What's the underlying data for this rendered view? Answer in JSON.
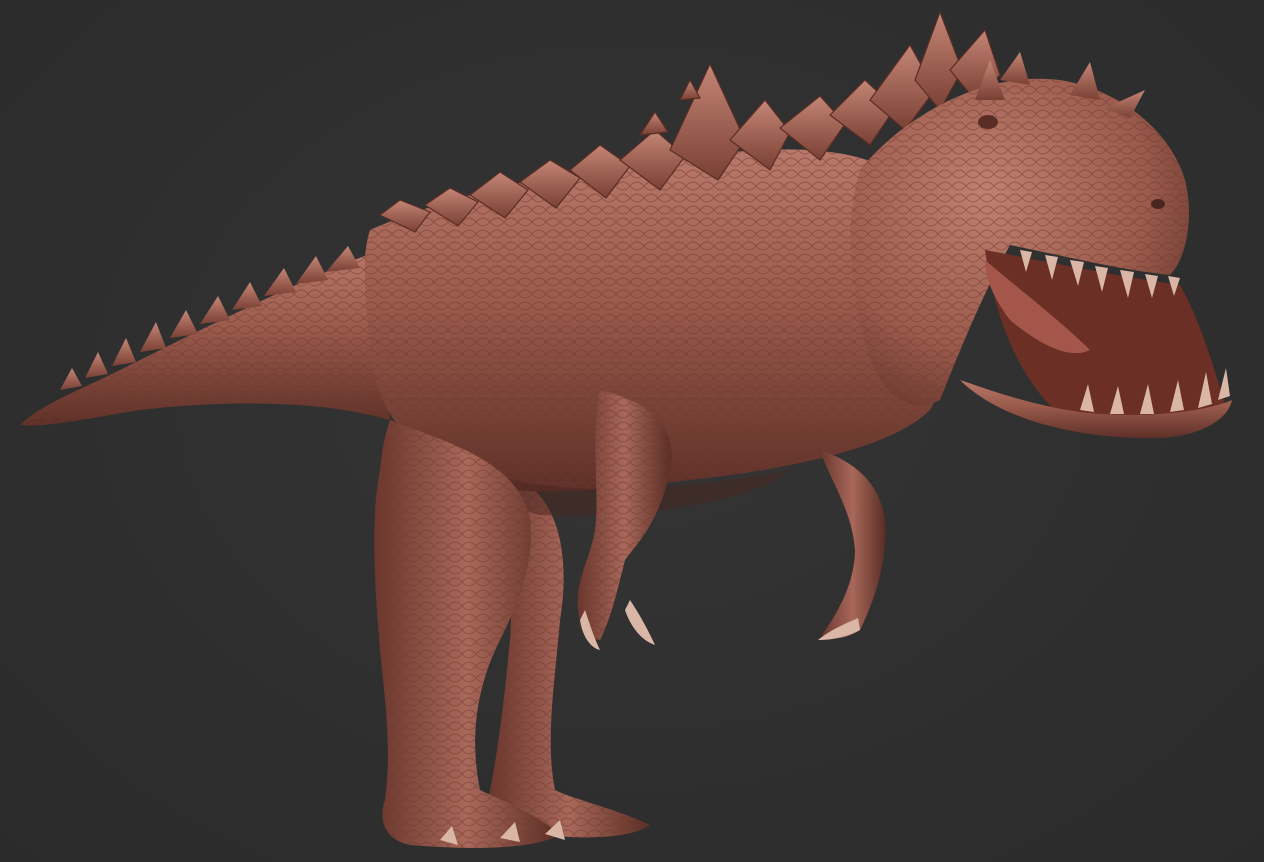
{
  "viewport": {
    "background_color": "#2f2f2f",
    "model_name": "",
    "material": "clay-skin",
    "colors": {
      "skin_base": "#9a5a4c",
      "skin_light": "#c58a78",
      "skin_shadow": "#4a2620",
      "spike": "#a8685a",
      "teeth": "#d9b6a6"
    }
  }
}
